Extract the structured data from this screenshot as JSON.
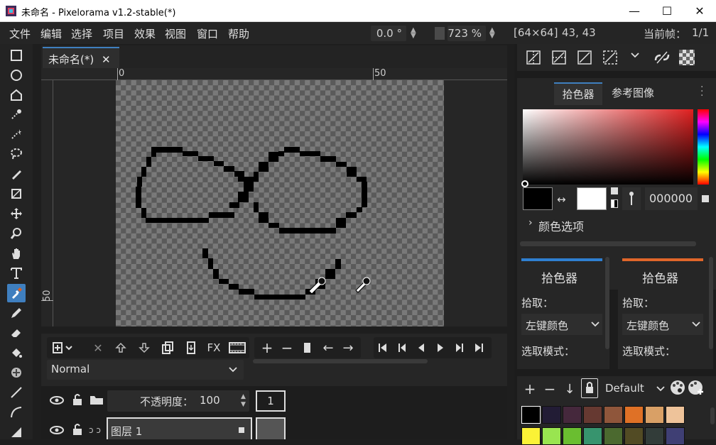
{
  "window": {
    "title": "未命名 - Pixelorama v1.2-stable(*)",
    "minimize": "—",
    "maximize": "☐",
    "close": "✕"
  },
  "menu": [
    "文件",
    "编辑",
    "选择",
    "项目",
    "效果",
    "视图",
    "窗口",
    "帮助"
  ],
  "toolbar_info": {
    "rotation": "0.0 °",
    "zoom": "723 %",
    "canvas_size": "[64×64]",
    "cursor_pos": "43, 43",
    "frame_label": "当前帧：",
    "frame_value": "1/1"
  },
  "tab": {
    "label": "未命名(*)",
    "close": "✕"
  },
  "rulers": {
    "top": [
      "0",
      "50"
    ],
    "left": [
      "50"
    ]
  },
  "tools": [
    "rectangle-select-icon",
    "ellipse-select-icon",
    "polygon-select-icon",
    "color-select-icon",
    "magic-wand-icon",
    "lasso-icon",
    "pen-select-icon",
    "crop-icon",
    "move-icon",
    "zoom-icon",
    "pan-icon",
    "text-icon",
    "color-picker-icon",
    "pencil-icon",
    "eraser-icon",
    "bucket-icon",
    "shading-icon",
    "line-icon",
    "curve-icon",
    "rectangle-icon"
  ],
  "layers": {
    "blend_mode": "Normal",
    "opacity_label": "不透明度：",
    "opacity_value": "100",
    "frame_number": "1",
    "layer_name": "图层 1"
  },
  "right_tabs": [
    "拾色器",
    "参考图像"
  ],
  "color": {
    "hex": "000000",
    "primary": "#000000",
    "secondary": "#ffffff",
    "options_label": "颜色选项"
  },
  "pickers": [
    {
      "title": "拾色器",
      "accent": "#2f7fd1",
      "pick_label": "拾取：",
      "mode_value": "左键颜色",
      "select_label": "选取模式："
    },
    {
      "title": "拾色器",
      "accent": "#e0662a",
      "pick_label": "拾取：",
      "mode_value": "左键颜色",
      "select_label": "选取模式："
    }
  ],
  "palette": {
    "name": "Default",
    "colors_row1": [
      "#000000",
      "#221c35",
      "#45283c",
      "#663931",
      "#8f563b",
      "#df7126",
      "#d9a066",
      "#eec39a"
    ],
    "colors_row2": [
      "#fbf236",
      "#99e550",
      "#6abe30",
      "#37946e",
      "#4b692f",
      "#524b24",
      "#323c39",
      "#3f3f74"
    ]
  }
}
